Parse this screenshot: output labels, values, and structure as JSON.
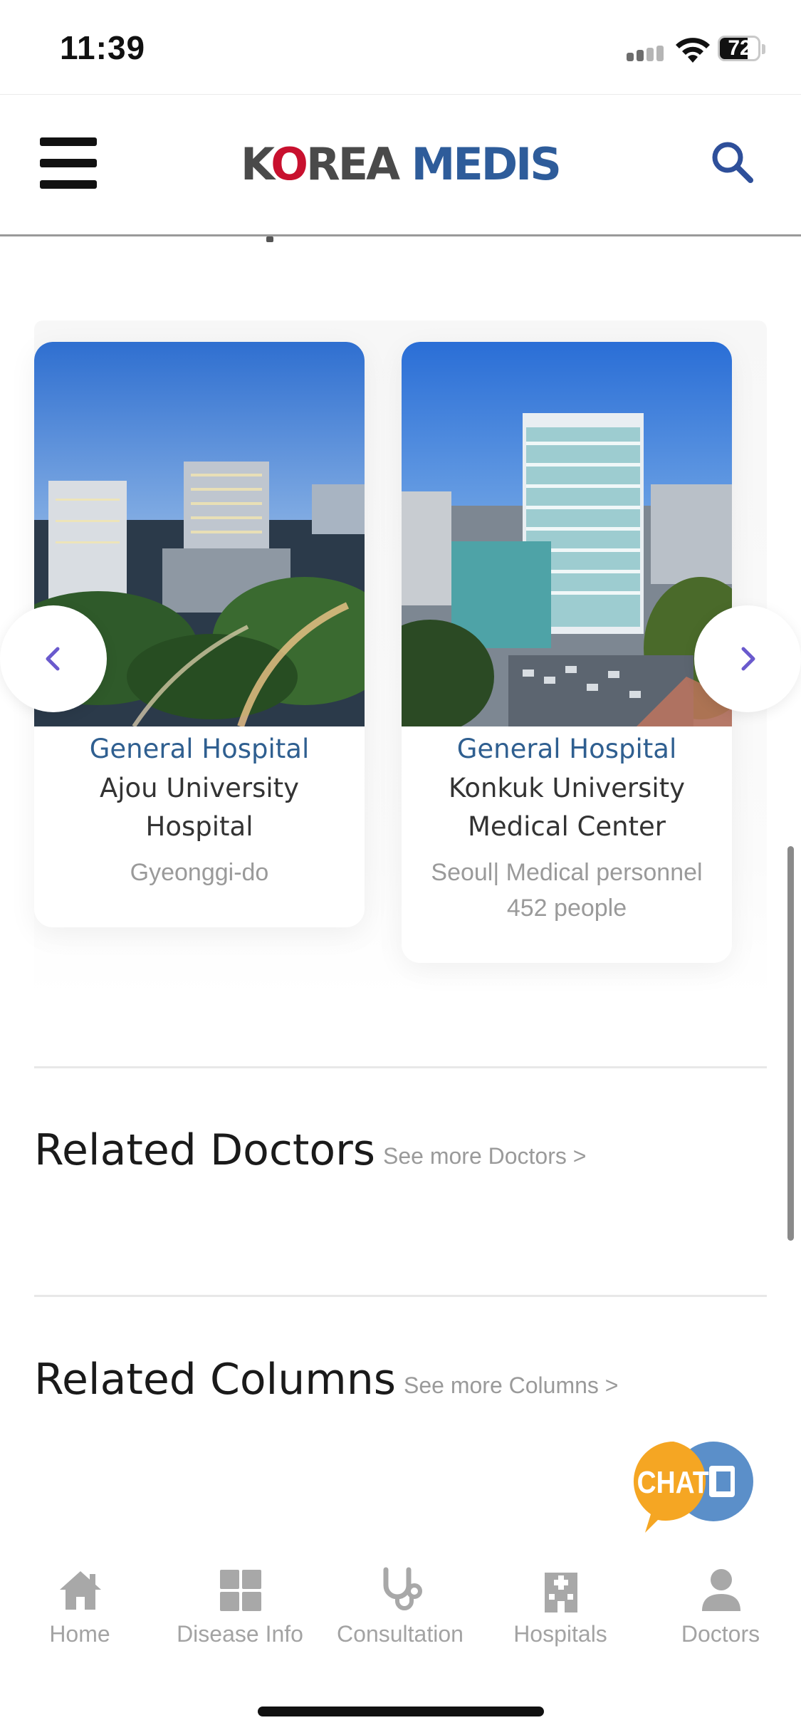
{
  "status_bar": {
    "time": "11:39",
    "battery": "72"
  },
  "header": {
    "logo_text": {
      "k": "K",
      "o": "O",
      "rea": "REA",
      "medis": "MEDIS"
    }
  },
  "hospitals": [
    {
      "category": "General Hospital",
      "name": "Ajou University Hospital",
      "location": "Gyeonggi-do"
    },
    {
      "category": "General Hospital",
      "name": "Konkuk University Medical Center",
      "location": "Seoul| Medical personnel 452 people"
    }
  ],
  "sections": {
    "doctors": {
      "title": "Related Doctors",
      "see_more": "See more Doctors >"
    },
    "columns": {
      "title": "Related Columns",
      "see_more": "See more Columns >"
    }
  },
  "chat": {
    "label": "CHAT"
  },
  "tabs": [
    {
      "label": "Home",
      "icon": "home-icon"
    },
    {
      "label": "Disease Info",
      "icon": "grid-icon"
    },
    {
      "label": "Consultation",
      "icon": "stethoscope-icon"
    },
    {
      "label": "Hospitals",
      "icon": "hospital-icon"
    },
    {
      "label": "Doctors",
      "icon": "person-icon"
    }
  ],
  "colors": {
    "accent_blue": "#2f5f90",
    "logo_red": "#c8102e",
    "arrow_purple": "#6a5acd",
    "chat_orange": "#f5a623",
    "chat_blue": "#5b8fc9",
    "tab_gray": "#a3a3a3"
  }
}
